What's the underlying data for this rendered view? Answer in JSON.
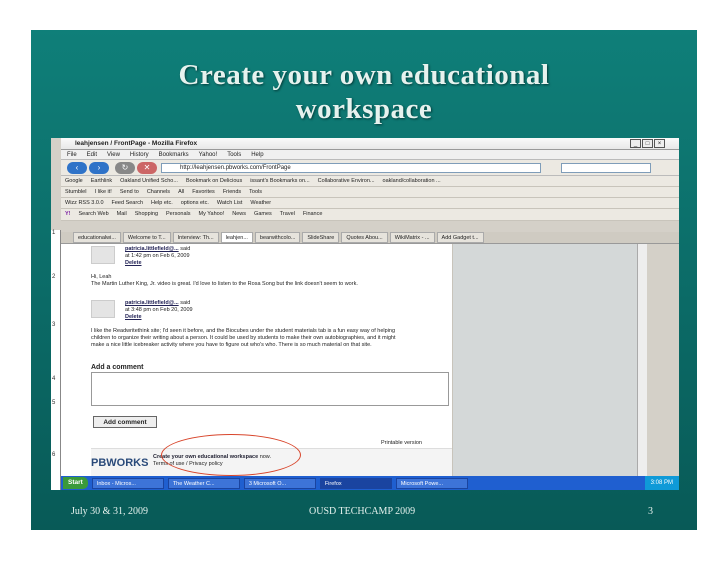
{
  "slide": {
    "title_line1": "Create your own  educational",
    "title_line2": "workspace",
    "footer_left": "July 30 & 31, 2009",
    "footer_center": "OUSD TECHCAMP 2009",
    "footer_right": "3"
  },
  "browser": {
    "window_title": "leahjensen / FrontPage - Mozilla Firefox",
    "menu": [
      "File",
      "Edit",
      "View",
      "History",
      "Bookmarks",
      "Yahoo!",
      "Tools",
      "Help"
    ],
    "url": "http://leahjensen.pbworks.com/FrontPage",
    "bookmarks": [
      "Google",
      "Earthlink",
      "Oakland Unified Scho...",
      "Bookmark on Delicious",
      "issant's Bookmarks on...",
      "Collaborative Environ...",
      "oakland/collaboration ..."
    ],
    "toolbar2": [
      "StumbleI",
      "I like it!",
      "Send to",
      "Channels",
      "All",
      "Favorites",
      "Friends",
      "Tools"
    ],
    "toolbar3": [
      "Wizz RSS 3.0.0",
      "Feed Search",
      "Help etc.",
      "options etc.",
      "Watch List",
      "Weather"
    ],
    "toolbar4": [
      "Search Web",
      "Mail",
      "Shopping",
      "Personals",
      "My Yahoo!",
      "News",
      "Games",
      "Travel",
      "Finance"
    ],
    "tabs": [
      "educationalwi...",
      "Welcome to T...",
      "Interview: Th...",
      "leahjen...",
      "bearwithcolo...",
      "SlideShare",
      "Quotes Abou...",
      "WikiMatrix - ...",
      "Add Gadget t..."
    ],
    "active_tab_index": 3
  },
  "page": {
    "comments": [
      {
        "user": "patricia.littlefield@...",
        "said": "said",
        "time": "at 1:42 pm on Feb 6, 2009",
        "delete": "Delete",
        "text": [
          "Hi, Leah",
          "The Martin Luther King, Jr. video is great.  I'd love to listen to the Rosa Song but the link doesn't seem to work."
        ]
      },
      {
        "user": "patricia.littlefield@...",
        "said": "said",
        "time": "at 3:48 pm on Feb 20, 2009",
        "delete": "Delete",
        "text": [
          "I like the Readwritethink site; I'd seen it before, and the Biocubes under the student materials tab is a fun easy way of helping",
          "children to organize their writing about a person.  It could be used by students to make their own autobiographies, and it might",
          "make a nice little icebreaker activity where you have to figure out who's who.  There is so much material on that site."
        ]
      }
    ],
    "add_comment_heading": "Add a comment",
    "add_comment_button": "Add comment",
    "printable_version": "Printable version",
    "pbworks_logo": "PBWORKS",
    "footer_line1": "Create your own educational workspace",
    "footer_line1_suffix": "now.",
    "footer_line2": "Terms of use / Privacy policy"
  },
  "line_numbers": [
    "1",
    "2",
    "3",
    "4",
    "5",
    "6"
  ],
  "taskbar": {
    "start": "Start",
    "tasks": [
      "Inbox - Micros...",
      "The Weather C...",
      "3 Microsoft O...",
      "Firefox",
      "Microsoft Powe..."
    ],
    "clock": "3:08 PM"
  }
}
